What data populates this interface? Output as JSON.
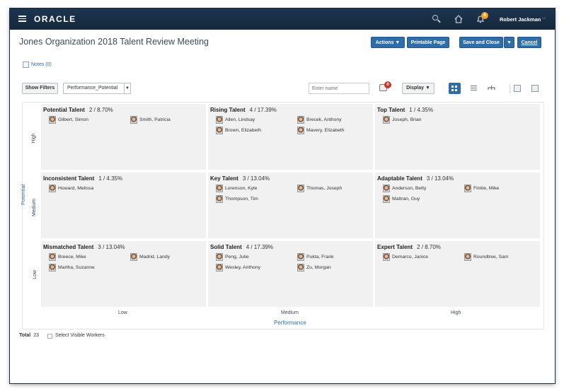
{
  "topbar": {
    "logo": "ORACLE",
    "user_name": "Robert Jackman",
    "notification_count": "6",
    "icons": [
      "hamburger-icon",
      "search-icon",
      "home-icon",
      "bell-icon",
      "chevron-down-icon"
    ]
  },
  "page": {
    "title": "Jones Organization 2018 Talent Review Meeting",
    "buttons": {
      "actions": "Actions ▼",
      "printable": "Printable Page",
      "save_close": "Save and Close",
      "save_dd": "▼",
      "cancel": "Cancel"
    },
    "notes": "Notes (0)"
  },
  "toolbar": {
    "show_filters": "Show Filters",
    "selected_view": "Performance_Potential",
    "name_placeholder": "Enter name",
    "people_badge": "0",
    "display": "Display ▼"
  },
  "grid": {
    "y_axis": "Potential",
    "x_axis": "Performance",
    "rows": [
      "High",
      "Medium",
      "Low"
    ],
    "cols": [
      "Low",
      "Medium",
      "High"
    ],
    "cells": [
      {
        "title": "Potential Talent",
        "stat": "2 / 8.70%",
        "workers": [
          "Gilbert, Simon",
          "Smith, Patricia"
        ]
      },
      {
        "title": "Rising Talent",
        "stat": "4 / 17.39%",
        "workers": [
          "Allen, Lindsay",
          "Brecek, Anthony",
          "Brown, Elizabeth",
          "Mavery, Elizabeth"
        ]
      },
      {
        "title": "Top Talent",
        "stat": "1 / 4.35%",
        "workers": [
          "Joseph, Brian"
        ]
      },
      {
        "title": "Inconsistent Talent",
        "stat": "1 / 4.35%",
        "workers": [
          "Howard, Melissa"
        ]
      },
      {
        "title": "Key Talent",
        "stat": "3 / 13.04%",
        "workers": [
          "Lorenson, Kyle",
          "Thomas, Joseph",
          "Thompson, Tim"
        ]
      },
      {
        "title": "Adaptable Talent",
        "stat": "3 / 13.04%",
        "workers": [
          "Anderson, Betty",
          "Finkle, Mike",
          "Mattran, Guy"
        ]
      },
      {
        "title": "Mismatched Talent",
        "stat": "3 / 13.04%",
        "workers": [
          "Breece, Mike",
          "Madrid, Landy",
          "Martha, Suzanne"
        ]
      },
      {
        "title": "Solid Talent",
        "stat": "4 / 17.39%",
        "workers": [
          "Peng, Julie",
          "Pukta, Frank",
          "Wesley, Anthony",
          "Zu, Morgan"
        ]
      },
      {
        "title": "Expert Talent",
        "stat": "2 / 8.70%",
        "workers": [
          "Demarco, Janice",
          "Roundtree, Sam"
        ]
      }
    ]
  },
  "footer": {
    "total_label": "Total",
    "total_value": "23",
    "select_visible": "Select Visible Workers"
  }
}
